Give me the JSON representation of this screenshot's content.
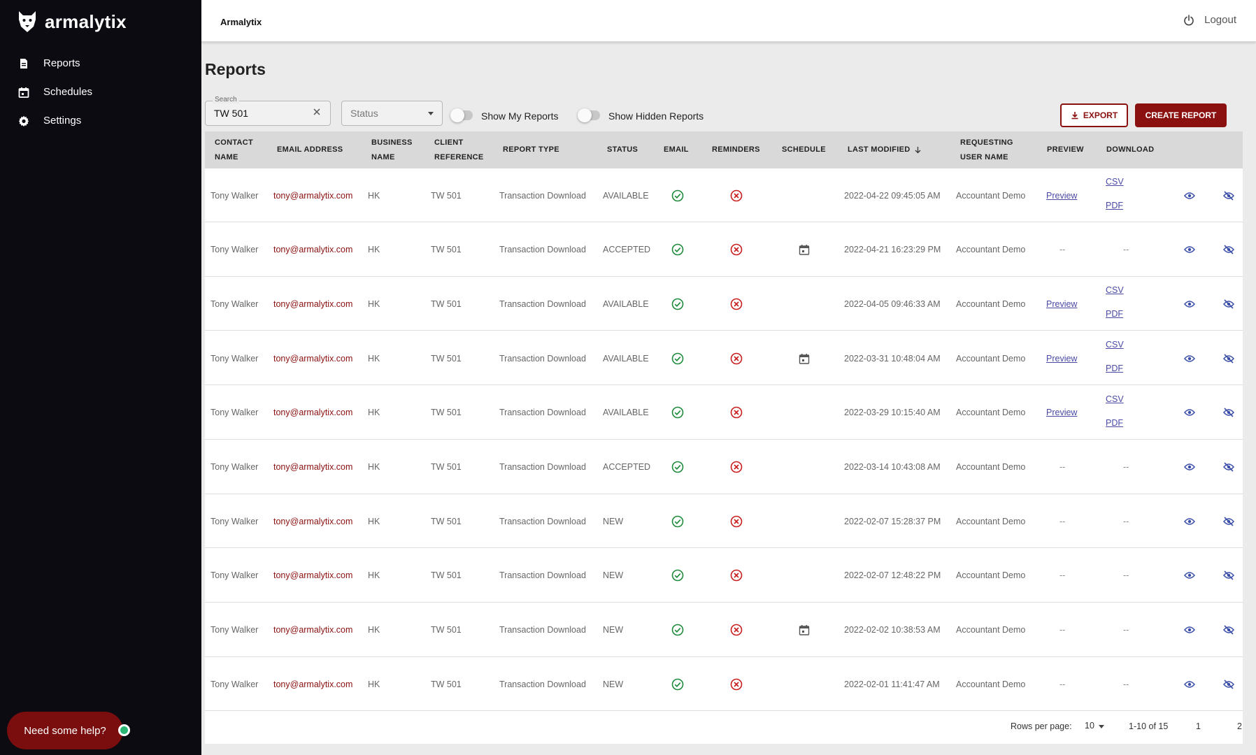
{
  "brand": {
    "name": "armalytix"
  },
  "sidebar": {
    "items": [
      {
        "label": "Reports",
        "icon": "document-icon"
      },
      {
        "label": "Schedules",
        "icon": "calendar-icon"
      },
      {
        "label": "Settings",
        "icon": "gear-icon"
      }
    ]
  },
  "help": {
    "label": "Need some help?"
  },
  "topbar": {
    "title": "Armalytix",
    "logout_label": "Logout"
  },
  "page": {
    "title": "Reports"
  },
  "filters": {
    "search_label": "Search",
    "search_value": "TW 501",
    "status_placeholder": "Status",
    "toggle_my": "Show My Reports",
    "toggle_hidden": "Show Hidden Reports"
  },
  "actions": {
    "export_label": "EXPORT",
    "create_label": "CREATE REPORT"
  },
  "table": {
    "headers": {
      "contact": [
        "CONTACT",
        "NAME"
      ],
      "email": "EMAIL ADDRESS",
      "business": [
        "BUSINESS",
        "NAME"
      ],
      "client": [
        "CLIENT",
        "REFERENCE"
      ],
      "report_type": "REPORT TYPE",
      "status": "STATUS",
      "email_col": "EMAIL",
      "reminders": "REMINDERS",
      "schedule": "SCHEDULE",
      "last_modified": "LAST MODIFIED",
      "requesting": [
        "REQUESTING",
        "USER NAME"
      ],
      "preview": "PREVIEW",
      "download": "DOWNLOAD"
    },
    "rows": [
      {
        "contact": "Tony Walker",
        "email": "tony@armalytix.com",
        "business": "HK",
        "client": "TW 501",
        "type": "Transaction Download",
        "status": "AVAILABLE",
        "schedule": false,
        "modified": "2022-04-22 09:45:05 AM",
        "user": "Accountant Demo",
        "preview": "Preview",
        "csv": "CSV",
        "pdf": "PDF"
      },
      {
        "contact": "Tony Walker",
        "email": "tony@armalytix.com",
        "business": "HK",
        "client": "TW 501",
        "type": "Transaction Download",
        "status": "ACCEPTED",
        "schedule": true,
        "modified": "2022-04-21 16:23:29 PM",
        "user": "Accountant Demo",
        "preview": "--",
        "download": "--"
      },
      {
        "contact": "Tony Walker",
        "email": "tony@armalytix.com",
        "business": "HK",
        "client": "TW 501",
        "type": "Transaction Download",
        "status": "AVAILABLE",
        "schedule": false,
        "modified": "2022-04-05 09:46:33 AM",
        "user": "Accountant Demo",
        "preview": "Preview",
        "csv": "CSV",
        "pdf": "PDF"
      },
      {
        "contact": "Tony Walker",
        "email": "tony@armalytix.com",
        "business": "HK",
        "client": "TW 501",
        "type": "Transaction Download",
        "status": "AVAILABLE",
        "schedule": true,
        "modified": "2022-03-31 10:48:04 AM",
        "user": "Accountant Demo",
        "preview": "Preview",
        "csv": "CSV",
        "pdf": "PDF"
      },
      {
        "contact": "Tony Walker",
        "email": "tony@armalytix.com",
        "business": "HK",
        "client": "TW 501",
        "type": "Transaction Download",
        "status": "AVAILABLE",
        "schedule": false,
        "modified": "2022-03-29 10:15:40 AM",
        "user": "Accountant Demo",
        "preview": "Preview",
        "csv": "CSV",
        "pdf": "PDF"
      },
      {
        "contact": "Tony Walker",
        "email": "tony@armalytix.com",
        "business": "HK",
        "client": "TW 501",
        "type": "Transaction Download",
        "status": "ACCEPTED",
        "schedule": false,
        "modified": "2022-03-14 10:43:08 AM",
        "user": "Accountant Demo",
        "preview": "--",
        "download": "--"
      },
      {
        "contact": "Tony Walker",
        "email": "tony@armalytix.com",
        "business": "HK",
        "client": "TW 501",
        "type": "Transaction Download",
        "status": "NEW",
        "schedule": false,
        "modified": "2022-02-07 15:28:37 PM",
        "user": "Accountant Demo",
        "preview": "--",
        "download": "--"
      },
      {
        "contact": "Tony Walker",
        "email": "tony@armalytix.com",
        "business": "HK",
        "client": "TW 501",
        "type": "Transaction Download",
        "status": "NEW",
        "schedule": false,
        "modified": "2022-02-07 12:48:22 PM",
        "user": "Accountant Demo",
        "preview": "--",
        "download": "--"
      },
      {
        "contact": "Tony Walker",
        "email": "tony@armalytix.com",
        "business": "HK",
        "client": "TW 501",
        "type": "Transaction Download",
        "status": "NEW",
        "schedule": true,
        "modified": "2022-02-02 10:38:53 AM",
        "user": "Accountant Demo",
        "preview": "--",
        "download": "--"
      },
      {
        "contact": "Tony Walker",
        "email": "tony@armalytix.com",
        "business": "HK",
        "client": "TW 501",
        "type": "Transaction Download",
        "status": "NEW",
        "schedule": false,
        "modified": "2022-02-01 11:41:47 AM",
        "user": "Accountant Demo",
        "preview": "--",
        "download": "--"
      }
    ]
  },
  "pagination": {
    "rows_per_page_label": "Rows per page:",
    "rows_per_page": "10",
    "range": "1-10 of 15",
    "pages": [
      "1",
      "2"
    ]
  },
  "colors": {
    "brand_red": "#8b1010",
    "success_green": "#1f8a3b",
    "error_red": "#c81e1e",
    "link_blue": "#4a4aa6",
    "sidebar_bg": "#0c0b12"
  }
}
